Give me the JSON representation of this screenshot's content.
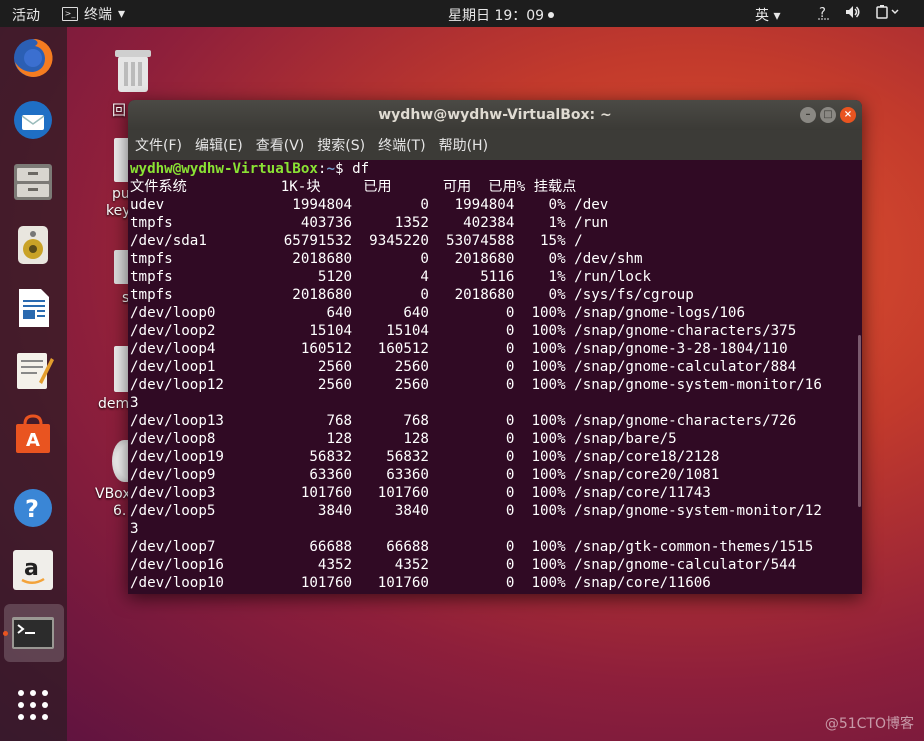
{
  "topbar": {
    "activities": "活动",
    "app_name": "终端",
    "app_arrow": "▾",
    "clock": "星期日 19：09",
    "ime": "英",
    "ime_arrow": "▾",
    "tray_icons": [
      "help-icon",
      "volume-icon",
      "power-icon"
    ]
  },
  "dock": {
    "apps": [
      "firefox-icon",
      "thunderbird-icon",
      "files-icon",
      "rhythmbox-icon",
      "writer-icon",
      "text-editor-icon",
      "software-icon",
      "help-icon",
      "amazon-icon",
      "terminal-icon",
      "app-grid-icon"
    ]
  },
  "desktop": {
    "labels": [
      "回",
      "pu",
      "key",
      "s",
      "dem",
      "VBox",
      "6."
    ]
  },
  "window": {
    "title": "wydhw@wydhw-VirtualBox: ~",
    "menu": [
      "文件(F)",
      "编辑(E)",
      "查看(V)",
      "搜索(S)",
      "终端(T)",
      "帮助(H)"
    ]
  },
  "terminal": {
    "prompt_user": "wydhw@wydhw-VirtualBox",
    "prompt_sep": ":",
    "prompt_path": "~",
    "prompt_end": "$ df",
    "header": "文件系统           1K-块     已用      可用  已用% 挂载点",
    "lines": [
      "udev               1994804        0   1994804    0% /dev",
      "tmpfs               403736     1352    402384    1% /run",
      "/dev/sda1         65791532  9345220  53074588   15% /",
      "tmpfs              2018680        0   2018680    0% /dev/shm",
      "tmpfs                 5120        4      5116    1% /run/lock",
      "tmpfs              2018680        0   2018680    0% /sys/fs/cgroup",
      "/dev/loop0             640      640         0  100% /snap/gnome-logs/106",
      "/dev/loop2           15104    15104         0  100% /snap/gnome-characters/375",
      "/dev/loop4          160512   160512         0  100% /snap/gnome-3-28-1804/110",
      "/dev/loop1            2560     2560         0  100% /snap/gnome-calculator/884",
      "/dev/loop12           2560     2560         0  100% /snap/gnome-system-monitor/16",
      "3",
      "/dev/loop13            768      768         0  100% /snap/gnome-characters/726",
      "/dev/loop8             128      128         0  100% /snap/bare/5",
      "/dev/loop19          56832    56832         0  100% /snap/core18/2128",
      "/dev/loop9           63360    63360         0  100% /snap/core20/1081",
      "/dev/loop3          101760   101760         0  100% /snap/core/11743",
      "/dev/loop5            3840     3840         0  100% /snap/gnome-system-monitor/12",
      "3",
      "/dev/loop7           66688    66688         0  100% /snap/gtk-common-themes/1515",
      "/dev/loop16           4352     4352         0  100% /snap/gnome-calculator/544",
      "/dev/loop10         101760   101760         0  100% /snap/core/11606"
    ]
  },
  "watermark": "@51CTO博客"
}
